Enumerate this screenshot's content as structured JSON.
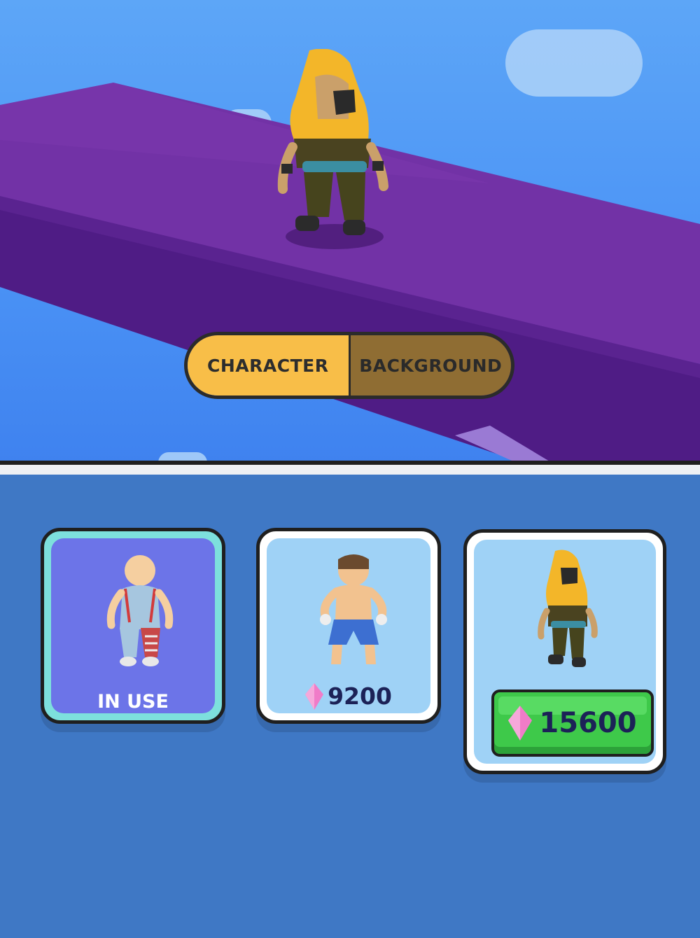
{
  "tabs": {
    "character_label": "CHARACTER",
    "background_label": "BACKGROUND",
    "active": "character"
  },
  "characters": [
    {
      "name": "wrestler",
      "status_label": "IN USE",
      "price": null
    },
    {
      "name": "boxer",
      "status_label": null,
      "price": "9200"
    },
    {
      "name": "hooded-ninja",
      "status_label": null,
      "price": "15600",
      "buy_button": true
    }
  ],
  "currency_icon": "pink-gem-icon",
  "colors": {
    "tab_active": "#f8be48",
    "tab_inactive": "#8f6d33",
    "panel_bg": "#3f78c5",
    "selected_card_bg": "#6c74e8",
    "card_bg": "#9fd2f6",
    "buy_button": "#3ec94a",
    "platform": "#6f2fa2"
  }
}
